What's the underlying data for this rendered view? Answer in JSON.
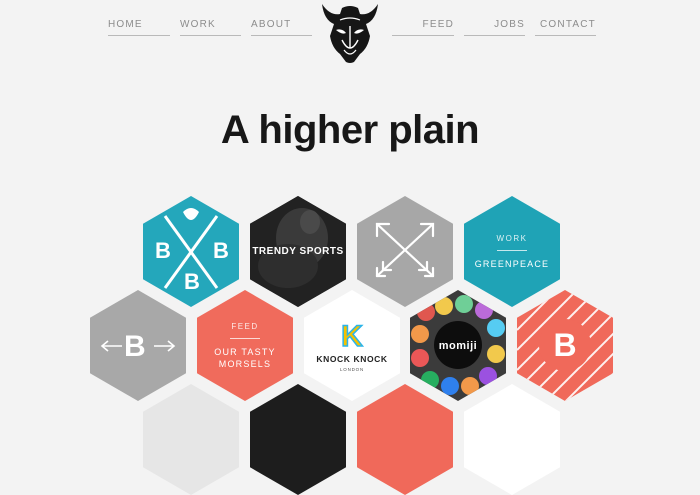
{
  "nav": {
    "home": "HOME",
    "work": "WORK",
    "about": "ABOUT",
    "feed": "FEED",
    "jobs": "JOBS",
    "contact": "CONTACT"
  },
  "logo_icon": "bison-head-icon",
  "headline": "A higher plain",
  "tiles": {
    "bb_logo": {
      "letters": [
        "B",
        "B",
        "B"
      ],
      "color": "#24a7bb"
    },
    "trendy_sports": {
      "label": "TRENDY SPORTS"
    },
    "crossed_arrows": {
      "icon": "crossed-arrows-icon",
      "color": "#a7a7a7"
    },
    "work_greenpeace": {
      "category": "WORK",
      "title": "GREENPEACE",
      "color": "#1fa3b6"
    },
    "b_arrows": {
      "letter": "B",
      "icon": "double-arrow-icon",
      "color": "#a8a8a8"
    },
    "feed_morsels": {
      "category": "FEED",
      "title_line1": "OUR TASTY",
      "title_line2": "MORSELS",
      "color": "#f06b5c"
    },
    "knock_knock": {
      "letter": "K",
      "name": "KNOCK KNOCK",
      "city": "LONDON"
    },
    "momiji": {
      "label": "momiji"
    },
    "striped_b": {
      "letter": "B",
      "color": "#f0695a"
    }
  },
  "colors": {
    "background": "#f3f3f3",
    "nav_text": "#8c8c8c",
    "headline": "#171717",
    "teal": "#24a7bb",
    "coral": "#f0695a",
    "grey": "#a8a8a8"
  }
}
